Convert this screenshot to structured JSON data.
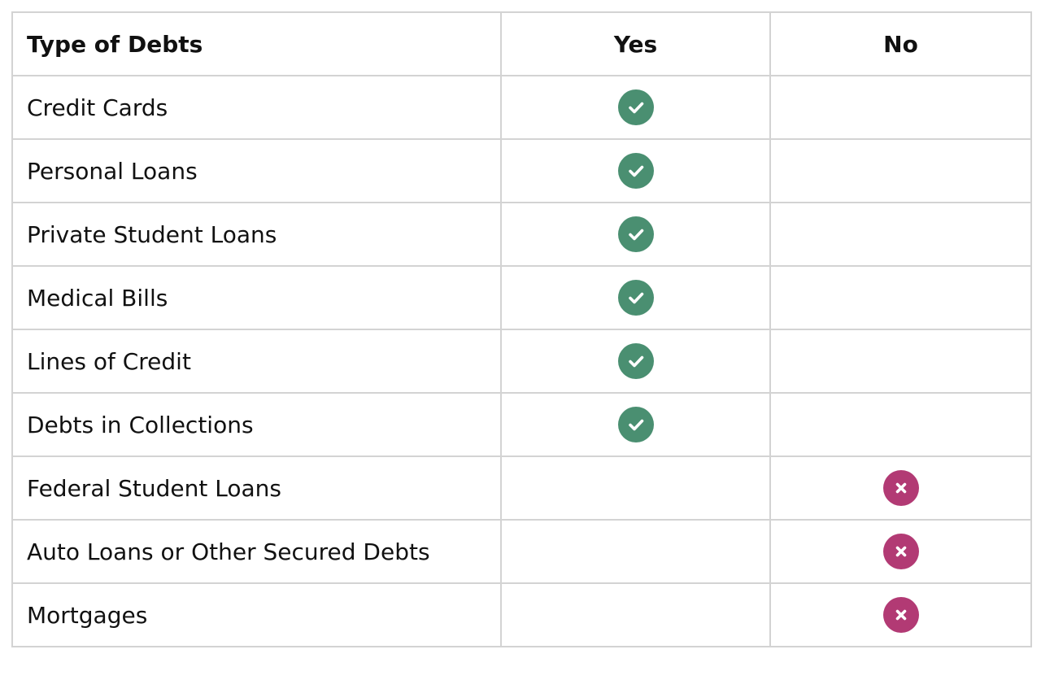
{
  "table": {
    "headers": [
      "Type of Debts",
      "Yes",
      "No"
    ],
    "rows": [
      {
        "label": "Credit Cards",
        "included": true
      },
      {
        "label": "Personal Loans",
        "included": true
      },
      {
        "label": "Private Student Loans",
        "included": true
      },
      {
        "label": "Medical Bills",
        "included": true
      },
      {
        "label": "Lines of Credit",
        "included": true
      },
      {
        "label": "Debts in Collections",
        "included": true
      },
      {
        "label": "Federal Student Loans",
        "included": false
      },
      {
        "label": "Auto Loans or Other Secured Debts",
        "included": false
      },
      {
        "label": "Mortgages",
        "included": false
      }
    ]
  },
  "icons": {
    "yes": "check-circle-icon",
    "no": "x-circle-icon"
  },
  "colors": {
    "yes_badge": "#4a8f71",
    "no_badge": "#b23a74",
    "border": "#d3d3d3"
  }
}
